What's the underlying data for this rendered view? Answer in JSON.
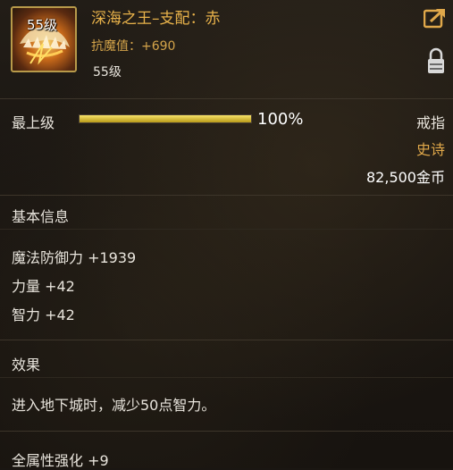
{
  "item": {
    "icon_level": "55级",
    "name": "深海之王–支配：赤",
    "resistance": "抗魔值：+690",
    "required_level": "55级"
  },
  "upgrade": {
    "label": "最上级",
    "progress": 1.0,
    "percent_text": "100%"
  },
  "meta": {
    "slot": "戒指",
    "rarity": "史诗",
    "price": "82,500金币",
    "rarity_color": "#e0a84a",
    "name_color": "#e8b24a"
  },
  "basic_info": {
    "title": "基本信息",
    "stats": [
      "魔法防御力 +1939",
      "力量 +42",
      "智力 +42"
    ]
  },
  "effect": {
    "title": "效果",
    "text": "进入地下城时，减少50点智力。",
    "enhance": "全属性强化 +9"
  },
  "icons": {
    "share": "share-icon",
    "lock": "lock-icon"
  }
}
